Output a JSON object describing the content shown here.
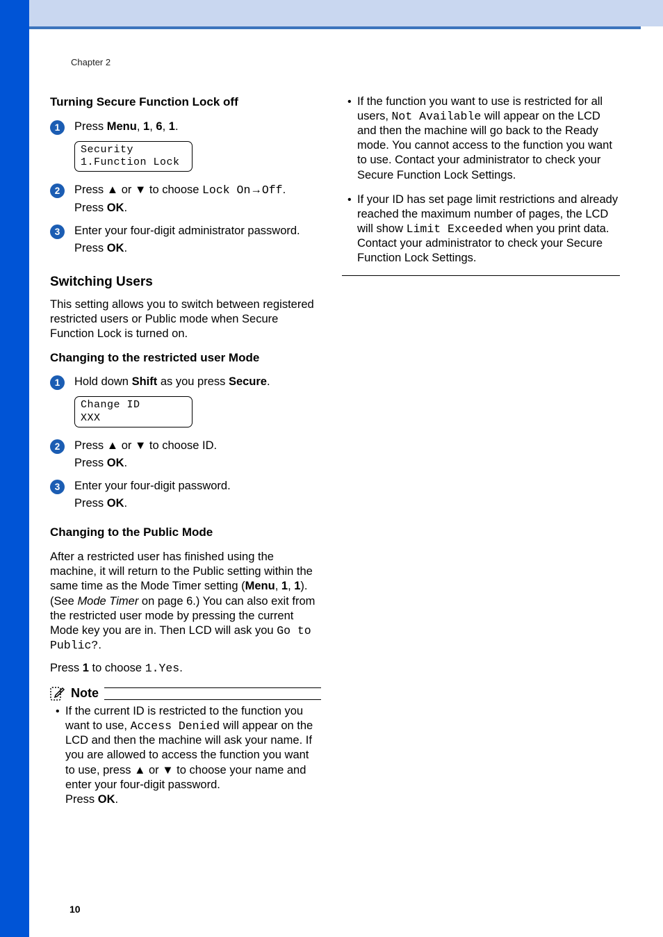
{
  "chapter_label": "Chapter 2",
  "page_number": "10",
  "left": {
    "turn_off_heading": "Turning Secure Function Lock off",
    "step1": {
      "num": "1",
      "pre": "Press ",
      "menu": "Menu",
      "c1": ", ",
      "k1": "1",
      "c2": ", ",
      "k6": "6",
      "c3": ", ",
      "k1b": "1",
      "dot": "."
    },
    "lcd1_line1": "Security",
    "lcd1_line2": "1.Function Lock",
    "step2": {
      "num": "2",
      "t1": "Press ",
      "up": "▲",
      "t2": " or ",
      "down": "▼",
      "t3": " to choose ",
      "mono": "Lock On",
      "arw": "→",
      "mono2": "Off",
      "dot": ".",
      "line2a": "Press ",
      "ok": "OK",
      "line2b": "."
    },
    "step3": {
      "num": "3",
      "l1": "Enter your four-digit administrator password.",
      "l2a": "Press ",
      "ok": "OK",
      "l2b": "."
    },
    "switching_heading": "Switching Users",
    "switching_para": "This setting allows you to switch between registered restricted users or Public mode when Secure Function Lock is turned on.",
    "restricted_heading": "Changing to the restricted user Mode",
    "rstep1": {
      "num": "1",
      "t1": "Hold down ",
      "shift": "Shift",
      "t2": " as you press ",
      "secure": "Secure",
      "dot": "."
    },
    "lcd2_line1": "Change ID",
    "lcd2_line2": "XXX",
    "rstep2": {
      "num": "2",
      "t1": "Press ",
      "up": "▲",
      "t2": " or ",
      "down": "▼",
      "t3": " to choose ID.",
      "l2a": "Press ",
      "ok": "OK",
      "l2b": "."
    },
    "rstep3": {
      "num": "3",
      "l1": "Enter your four-digit password.",
      "l2a": "Press ",
      "ok": "OK",
      "l2b": "."
    },
    "public_heading": "Changing to the Public Mode",
    "public_para_1a": "After a restricted user has finished using the machine, it will return to the Public setting within the same time as the Mode Timer setting (",
    "menu_b": "Menu",
    "pc1": ", ",
    "pk1": "1",
    "pc2": ", ",
    "pk1b": "1",
    "public_para_1b": "). (See ",
    "italic_ref": "Mode Timer",
    "public_para_1c": " on page 6.) You can also exit from the restricted user mode by pressing the current Mode key you are in. Then LCD will ask you ",
    "go_public": "Go to Public?",
    "public_para_1d": ".",
    "public_line2a": "Press ",
    "public_key1": "1",
    "public_line2b": " to choose ",
    "public_mono": "1.Yes",
    "public_line2c": ".",
    "note_label": "Note",
    "note_bullet1_a": "If the current ID is restricted to the function you want to use, ",
    "note_bullet1_mono": "Access Denied",
    "note_bullet1_b": " will appear on the LCD and then the machine will ask your name. If you are allowed to access the function you want to use, press ",
    "note_up": "▲",
    "note_or": " or ",
    "note_down": "▼",
    "note_bullet1_c": " to choose your name and enter your four-digit password.",
    "note_press": "Press ",
    "note_ok": "OK",
    "note_dot": "."
  },
  "right": {
    "bullet2_a": "If the function you want to use is restricted for all users, ",
    "bullet2_mono": "Not Available",
    "bullet2_b": " will appear on the LCD and then the machine will go back to the Ready mode. You cannot access to the function you want to use. Contact your administrator to check your Secure Function Lock Settings.",
    "bullet3_a": "If your ID has set page limit restrictions and already reached the maximum number of pages, the LCD will show ",
    "bullet3_mono": "Limit Exceeded",
    "bullet3_b": " when you print data. Contact your administrator to check your Secure Function Lock Settings."
  }
}
